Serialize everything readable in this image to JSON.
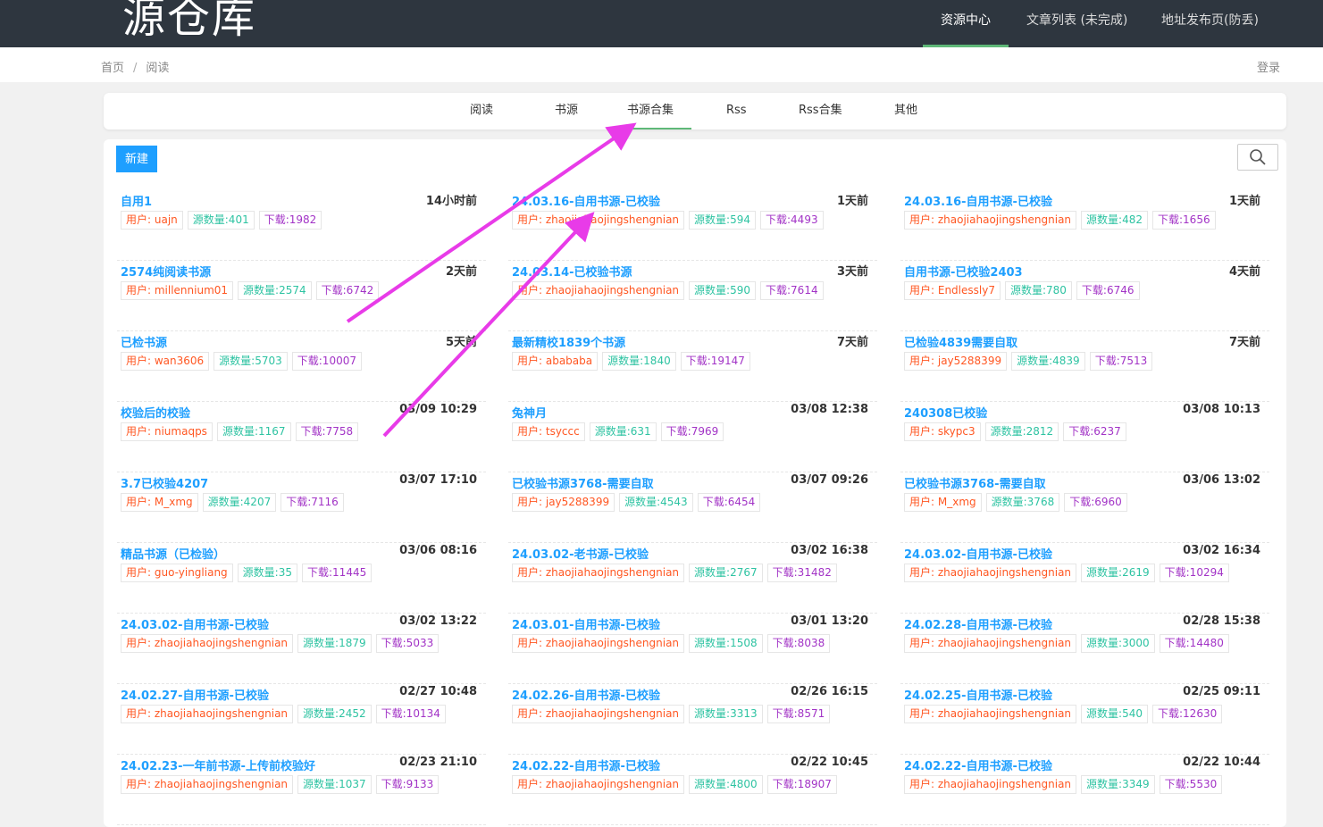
{
  "site": {
    "logo": "源仓库"
  },
  "nav": [
    {
      "label": "资源中心",
      "active": true
    },
    {
      "label": "文章列表 (未完成)",
      "active": false
    },
    {
      "label": "地址发布页(防丢)",
      "active": false
    }
  ],
  "breadcrumb": {
    "home": "首页",
    "separator": "/",
    "current": "阅读"
  },
  "login_label": "登录",
  "tabs": [
    {
      "label": "阅读"
    },
    {
      "label": "书源"
    },
    {
      "label": "书源合集",
      "active": true
    },
    {
      "label": "Rss"
    },
    {
      "label": "Rss合集"
    },
    {
      "label": "其他"
    }
  ],
  "new_button_label": "新建",
  "colors": {
    "accent": "#1e9fff",
    "user": "#ff5722",
    "count": "#2ec3a2",
    "download": "#a233c6",
    "annotation": "#e83be8",
    "tab_active": "#5fb878"
  },
  "items": [
    {
      "title": "自用1",
      "time": "14小时前",
      "user": "用户: uajn",
      "count": "源数量:401",
      "downloads": "下载:1982"
    },
    {
      "title": "24.03.16-自用书源-已校验",
      "time": "1天前",
      "user": "用户: zhaojiahaojingshengnian",
      "count": "源数量:594",
      "downloads": "下载:4493"
    },
    {
      "title": "24.03.16-自用书源-已校验",
      "time": "1天前",
      "user": "用户: zhaojiahaojingshengnian",
      "count": "源数量:482",
      "downloads": "下载:1656"
    },
    {
      "title": "2574纯阅读书源",
      "time": "2天前",
      "user": "用户: millennium01",
      "count": "源数量:2574",
      "downloads": "下载:6742"
    },
    {
      "title": "24.03.14-已校验书源",
      "time": "3天前",
      "user": "用户: zhaojiahaojingshengnian",
      "count": "源数量:590",
      "downloads": "下载:7614"
    },
    {
      "title": "自用书源-已校验2403",
      "time": "4天前",
      "user": "用户: Endlessly7",
      "count": "源数量:780",
      "downloads": "下载:6746"
    },
    {
      "title": "已检书源",
      "time": "5天前",
      "user": "用户: wan3606",
      "count": "源数量:5703",
      "downloads": "下载:10007"
    },
    {
      "title": "最新精校1839个书源",
      "time": "7天前",
      "user": "用户: abababa",
      "count": "源数量:1840",
      "downloads": "下载:19147"
    },
    {
      "title": "已检验4839需要自取",
      "time": "7天前",
      "user": "用户: jay5288399",
      "count": "源数量:4839",
      "downloads": "下载:7513"
    },
    {
      "title": "校验后的校验",
      "time": "03/09 10:29",
      "user": "用户: niumaqps",
      "count": "源数量:1167",
      "downloads": "下载:7758"
    },
    {
      "title": "兔神月",
      "time": "03/08 12:38",
      "user": "用户: tsyccc",
      "count": "源数量:631",
      "downloads": "下载:7969"
    },
    {
      "title": "240308已校验",
      "time": "03/08 10:13",
      "user": "用户: skypc3",
      "count": "源数量:2812",
      "downloads": "下载:6237"
    },
    {
      "title": "3.7已校验4207",
      "time": "03/07 17:10",
      "user": "用户: M_xmg",
      "count": "源数量:4207",
      "downloads": "下载:7116"
    },
    {
      "title": "已校验书源3768-需要自取",
      "time": "03/07 09:26",
      "user": "用户: jay5288399",
      "count": "源数量:4543",
      "downloads": "下载:6454"
    },
    {
      "title": "已校验书源3768-需要自取",
      "time": "03/06 13:02",
      "user": "用户: M_xmg",
      "count": "源数量:3768",
      "downloads": "下载:6960"
    },
    {
      "title": "精品书源（已检验）",
      "time": "03/06 08:16",
      "user": "用户: guo-yingliang",
      "count": "源数量:35",
      "downloads": "下载:11445"
    },
    {
      "title": "24.03.02-老书源-已校验",
      "time": "03/02 16:38",
      "user": "用户: zhaojiahaojingshengnian",
      "count": "源数量:2767",
      "downloads": "下载:31482"
    },
    {
      "title": "24.03.02-自用书源-已校验",
      "time": "03/02 16:34",
      "user": "用户: zhaojiahaojingshengnian",
      "count": "源数量:2619",
      "downloads": "下载:10294"
    },
    {
      "title": "24.03.02-自用书源-已校验",
      "time": "03/02 13:22",
      "user": "用户: zhaojiahaojingshengnian",
      "count": "源数量:1879",
      "downloads": "下载:5033"
    },
    {
      "title": "24.03.01-自用书源-已校验",
      "time": "03/01 13:20",
      "user": "用户: zhaojiahaojingshengnian",
      "count": "源数量:1508",
      "downloads": "下载:8038"
    },
    {
      "title": "24.02.28-自用书源-已校验",
      "time": "02/28 15:38",
      "user": "用户: zhaojiahaojingshengnian",
      "count": "源数量:3000",
      "downloads": "下载:14480"
    },
    {
      "title": "24.02.27-自用书源-已校验",
      "time": "02/27 10:48",
      "user": "用户: zhaojiahaojingshengnian",
      "count": "源数量:2452",
      "downloads": "下载:10134"
    },
    {
      "title": "24.02.26-自用书源-已校验",
      "time": "02/26 16:15",
      "user": "用户: zhaojiahaojingshengnian",
      "count": "源数量:3313",
      "downloads": "下载:8571"
    },
    {
      "title": "24.02.25-自用书源-已校验",
      "time": "02/25 09:11",
      "user": "用户: zhaojiahaojingshengnian",
      "count": "源数量:540",
      "downloads": "下载:12630"
    },
    {
      "title": "24.02.23-一年前书源-上传前校验好",
      "time": "02/23 21:10",
      "user": "用户: zhaojiahaojingshengnian",
      "count": "源数量:1037",
      "downloads": "下载:9133"
    },
    {
      "title": "24.02.22-自用书源-已校验",
      "time": "02/22 10:45",
      "user": "用户: zhaojiahaojingshengnian",
      "count": "源数量:4800",
      "downloads": "下载:18907"
    },
    {
      "title": "24.02.22-自用书源-已校验",
      "time": "02/22 10:44",
      "user": "用户: zhaojiahaojingshengnian",
      "count": "源数量:3349",
      "downloads": "下载:5530"
    }
  ]
}
